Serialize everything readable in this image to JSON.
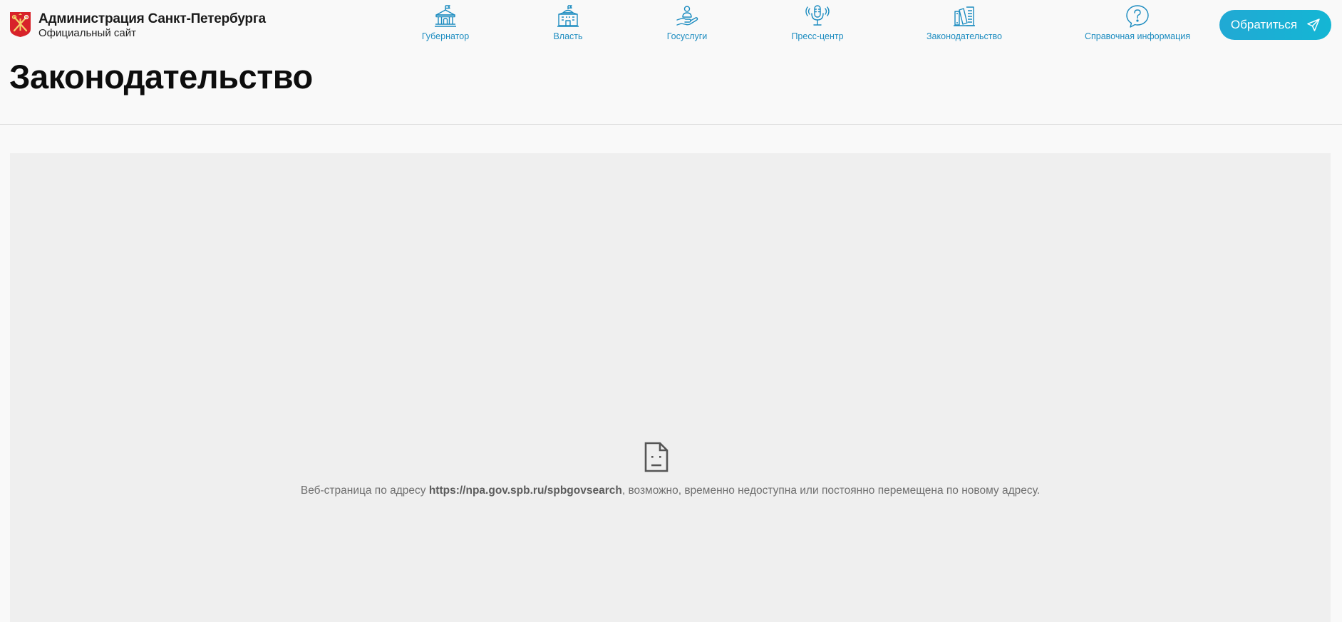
{
  "header": {
    "brand_title": "Администрация Санкт-Петербурга",
    "brand_subtitle": "Официальный сайт",
    "logo_icon": "spb-coat-of-arms-icon",
    "nav": [
      {
        "label": "Губернатор",
        "icon": "governor-building-icon"
      },
      {
        "label": "Власть",
        "icon": "government-building-icon"
      },
      {
        "label": "Госуслуги",
        "icon": "services-hand-icon"
      },
      {
        "label": "Пресс-центр",
        "icon": "microphone-icon"
      },
      {
        "label": "Законодательство",
        "icon": "law-books-icon"
      },
      {
        "label": "Справочная информация",
        "icon": "question-bubble-icon"
      }
    ],
    "contact_button": "Обратиться",
    "contact_icon": "paper-plane-icon"
  },
  "page": {
    "title": "Законодательство"
  },
  "embed_error": {
    "icon": "broken-page-icon",
    "text_before": "Веб-страница по адресу ",
    "url": "https://npa.gov.spb.ru/spbgovsearch",
    "text_after": ", возможно, временно недоступна или постоянно перемещена по новому адресу."
  },
  "colors": {
    "accent": "#1c8cc0",
    "button_start": "#21a9d4",
    "button_end": "#14b6d4",
    "logo_red": "#d8232a",
    "frame_bg": "#efefef",
    "page_bg": "#f9f9f9"
  }
}
